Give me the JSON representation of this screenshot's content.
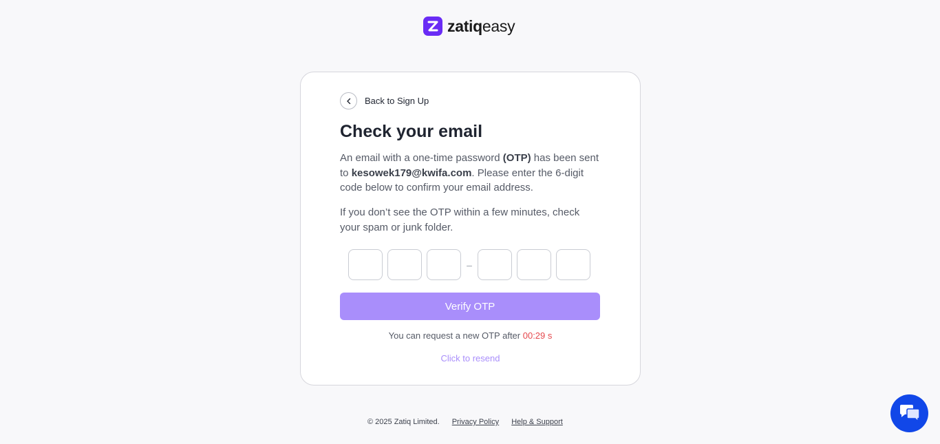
{
  "brand": {
    "name_bold": "zatiq",
    "name_light": "easy",
    "accent": "#6a2cf5"
  },
  "card": {
    "back_label": "Back to Sign Up",
    "title": "Check your email",
    "desc_part1": "An email with a one-time password ",
    "desc_otp": "(OTP)",
    "desc_part2": " has been sent to ",
    "email": "kesowek179@kwifa.com",
    "desc_part3": ". Please enter the 6-digit code below to confirm your email address.",
    "desc2": "If you don’t see the OTP within a few minutes, check your spam or junk folder.",
    "otp_separator": "–",
    "verify_label": "Verify OTP",
    "timer_prefix": "You can request a new OTP after ",
    "timer_value": "00:29 s",
    "resend_label": "Click to resend"
  },
  "footer": {
    "copyright": "© 2025 Zatiq Limited.",
    "privacy": "Privacy Policy",
    "help": "Help & Support"
  },
  "colors": {
    "button": "#a98efb",
    "timer": "#e5484d",
    "chat": "#1147e8"
  }
}
